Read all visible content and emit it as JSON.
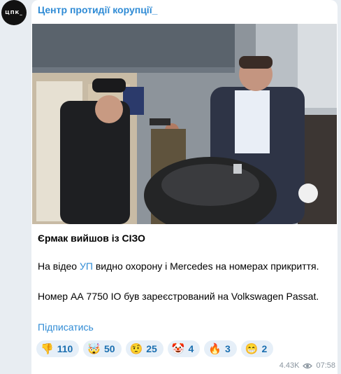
{
  "channel": {
    "avatar_text": "ЦПК_",
    "name": "Центр протидії корупції_"
  },
  "post": {
    "title": "Єрмак вийшов із СІЗО",
    "p1_before": "На відео ",
    "p1_link": "УП",
    "p1_after": " видно охорону і Mercedes на номерах прикриття.",
    "p2": "Номер АА 7750 ІО був зареєстрований на Volkswagen Passat.",
    "subscribe_label": "Підписатись"
  },
  "reactions": [
    {
      "icon": "thumbs-down-icon",
      "emoji": "👎",
      "count": "110"
    },
    {
      "icon": "exploding-head-icon",
      "emoji": "🤯",
      "count": "50"
    },
    {
      "icon": "raised-eyebrow-icon",
      "emoji": "🤨",
      "count": "25"
    },
    {
      "icon": "clown-icon",
      "emoji": "🤡",
      "count": "4"
    },
    {
      "icon": "fire-icon",
      "emoji": "🔥",
      "count": "3"
    },
    {
      "icon": "grin-icon",
      "emoji": "😁",
      "count": "2"
    }
  ],
  "meta": {
    "views": "4.43K",
    "time": "07:58"
  },
  "colors": {
    "link": "#2f8bd5",
    "background": "#e8edf2",
    "reaction_bg": "#e6eff8"
  }
}
